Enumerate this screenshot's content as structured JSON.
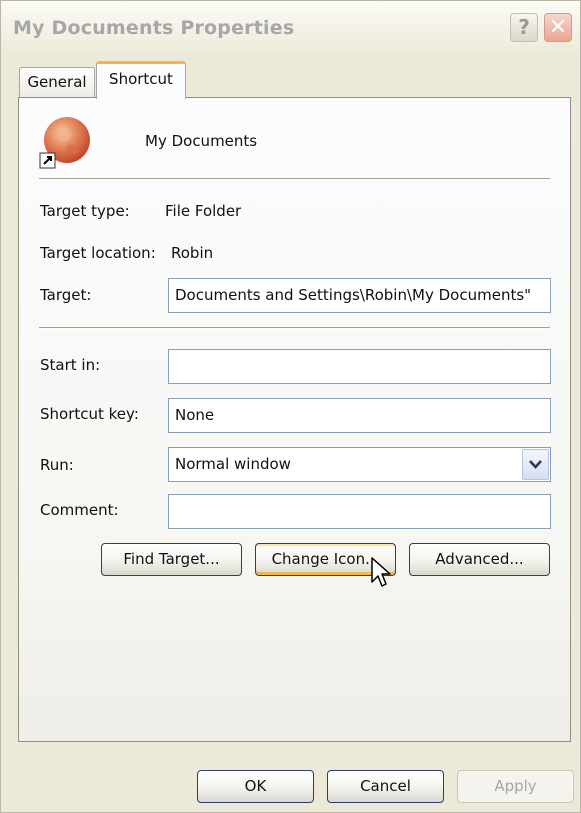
{
  "window": {
    "title": "My Documents Properties",
    "help_label": "?",
    "close_label": "✕"
  },
  "tabs": [
    {
      "label": "General",
      "active": false
    },
    {
      "label": "Shortcut",
      "active": true
    }
  ],
  "shortcut": {
    "name": "My Documents",
    "icon": "shortcut-folder-icon",
    "target_type_label": "Target type:",
    "target_type_value": "File Folder",
    "target_location_label": "Target location:",
    "target_location_value": "Robin",
    "target_label": "Target:",
    "target_value": "Documents and Settings\\Robin\\My Documents\"",
    "start_in_label": "Start in:",
    "start_in_value": "",
    "shortcut_key_label": "Shortcut key:",
    "shortcut_key_value": "None",
    "run_label": "Run:",
    "run_value": "Normal window",
    "comment_label": "Comment:",
    "comment_value": ""
  },
  "actions": {
    "find_target": "Find Target...",
    "change_icon": "Change Icon...",
    "advanced": "Advanced..."
  },
  "dialog_buttons": {
    "ok": "OK",
    "cancel": "Cancel",
    "apply": "Apply"
  },
  "colors": {
    "window_bg": "#ece9d8",
    "hover_accent": "#f1b84e",
    "button_border": "#2d3e6b"
  }
}
